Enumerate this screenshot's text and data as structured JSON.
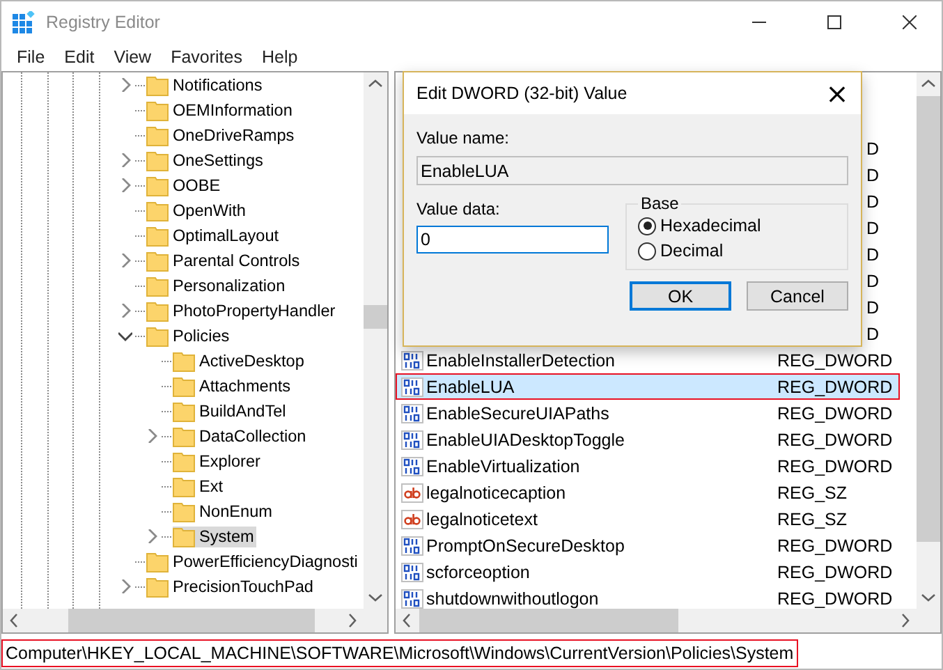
{
  "window": {
    "title": "Registry Editor"
  },
  "menu": [
    "File",
    "Edit",
    "View",
    "Favorites",
    "Help"
  ],
  "tree": [
    {
      "label": "Notifications",
      "expandable": true,
      "expanded": false
    },
    {
      "label": "OEMInformation",
      "expandable": false
    },
    {
      "label": "OneDriveRamps",
      "expandable": false
    },
    {
      "label": "OneSettings",
      "expandable": true,
      "expanded": false
    },
    {
      "label": "OOBE",
      "expandable": true,
      "expanded": false
    },
    {
      "label": "OpenWith",
      "expandable": false
    },
    {
      "label": "OptimalLayout",
      "expandable": false
    },
    {
      "label": "Parental Controls",
      "expandable": true,
      "expanded": false
    },
    {
      "label": "Personalization",
      "expandable": false
    },
    {
      "label": "PhotoPropertyHandler",
      "expandable": true,
      "expanded": false
    },
    {
      "label": "Policies",
      "expandable": true,
      "expanded": true,
      "children": [
        {
          "label": "ActiveDesktop",
          "expandable": false,
          "selected": false
        },
        {
          "label": "Attachments",
          "expandable": false,
          "selected": false
        },
        {
          "label": "BuildAndTel",
          "expandable": false,
          "selected": false
        },
        {
          "label": "DataCollection",
          "expandable": true,
          "expanded": false,
          "selected": false
        },
        {
          "label": "Explorer",
          "expandable": false,
          "selected": false
        },
        {
          "label": "Ext",
          "expandable": false,
          "selected": false
        },
        {
          "label": "NonEnum",
          "expandable": false,
          "selected": false
        },
        {
          "label": "System",
          "expandable": true,
          "expanded": false,
          "selected": true
        }
      ]
    },
    {
      "label": "PowerEfficiencyDiagnosti",
      "expandable": false
    },
    {
      "label": "PrecisionTouchPad",
      "expandable": true,
      "expanded": false
    }
  ],
  "values": [
    {
      "type": "D"
    },
    {
      "type": "D"
    },
    {
      "type": "D"
    },
    {
      "type": "D"
    },
    {
      "type": "D"
    },
    {
      "type": "D"
    },
    {
      "type": "D"
    },
    {
      "type": "D"
    },
    {
      "kind": "dword",
      "name": "EnableInstallerDetection",
      "type": "REG_DWORD",
      "selected": false
    },
    {
      "kind": "dword",
      "name": "EnableLUA",
      "type": "REG_DWORD",
      "selected": true,
      "annotated": true
    },
    {
      "kind": "dword",
      "name": "EnableSecureUIAPaths",
      "type": "REG_DWORD",
      "selected": false
    },
    {
      "kind": "dword",
      "name": "EnableUIADesktopToggle",
      "type": "REG_DWORD",
      "selected": false
    },
    {
      "kind": "dword",
      "name": "EnableVirtualization",
      "type": "REG_DWORD",
      "selected": false
    },
    {
      "kind": "string",
      "name": "legalnoticecaption",
      "type": "REG_SZ",
      "selected": false
    },
    {
      "kind": "string",
      "name": "legalnoticetext",
      "type": "REG_SZ",
      "selected": false
    },
    {
      "kind": "dword",
      "name": "PromptOnSecureDesktop",
      "type": "REG_DWORD",
      "selected": false
    },
    {
      "kind": "dword",
      "name": "scforceoption",
      "type": "REG_DWORD",
      "selected": false
    },
    {
      "kind": "dword",
      "name": "shutdownwithoutlogon",
      "type": "REG_DWORD",
      "selected": false
    }
  ],
  "status_bar": {
    "path": "Computer\\HKEY_LOCAL_MACHINE\\SOFTWARE\\Microsoft\\Windows\\CurrentVersion\\Policies\\System",
    "annotated": true
  },
  "dialog": {
    "title": "Edit DWORD (32-bit) Value",
    "close": "×",
    "name_label": "Value name:",
    "name_value": "EnableLUA",
    "data_label": "Value data:",
    "data_value": "0",
    "base_label": "Base",
    "bases": [
      {
        "label": "Hexadecimal",
        "selected": true
      },
      {
        "label": "Decimal",
        "selected": false
      }
    ],
    "buttons": [
      {
        "label": "OK",
        "default": true
      },
      {
        "label": "Cancel",
        "default": false
      }
    ]
  }
}
